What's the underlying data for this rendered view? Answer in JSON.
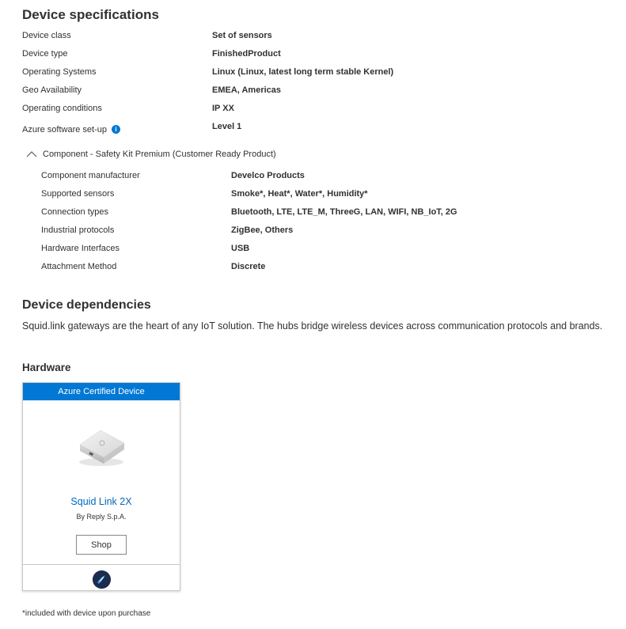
{
  "specs": {
    "title": "Device specifications",
    "rows": [
      {
        "label": "Device class",
        "value": "Set of sensors"
      },
      {
        "label": "Device type",
        "value": "FinishedProduct"
      },
      {
        "label": "Operating Systems",
        "value": "Linux (Linux, latest long term stable Kernel)"
      },
      {
        "label": "Geo Availability",
        "value": "EMEA, Americas"
      },
      {
        "label": "Operating conditions",
        "value": "IP XX"
      },
      {
        "label": "Azure software set-up",
        "value": "Level 1"
      }
    ],
    "info_icon_glyph": "i"
  },
  "component": {
    "toggle_label": "Component - Safety Kit Premium (Customer Ready Product)",
    "expanded_icon": "chevron-up-icon",
    "rows": [
      {
        "label": "Component manufacturer",
        "value": "Develco Products"
      },
      {
        "label": "Supported sensors",
        "value": "Smoke*, Heat*, Water*, Humidity*"
      },
      {
        "label": "Connection types",
        "value": "Bluetooth, LTE, LTE_M, ThreeG, LAN, WIFI, NB_IoT, 2G"
      },
      {
        "label": "Industrial protocols",
        "value": "ZigBee, Others"
      },
      {
        "label": "Hardware Interfaces",
        "value": "USB"
      },
      {
        "label": "Attachment Method",
        "value": "Discrete"
      }
    ]
  },
  "dependencies": {
    "title": "Device dependencies",
    "description": "Squid.link gateways are the heart of any IoT solution. The hubs bridge wireless devices across communication protocols and brands.",
    "hardware_title": "Hardware"
  },
  "card": {
    "banner": "Azure Certified Device",
    "product_name": "Squid Link 2X",
    "by": "By Reply S.p.A.",
    "shop_label": "Shop",
    "badge_icon": "certified-badge-icon"
  },
  "footnote": "*included with device upon purchase",
  "colors": {
    "accent": "#0078d4",
    "link": "#0067b8",
    "text": "#323130"
  }
}
